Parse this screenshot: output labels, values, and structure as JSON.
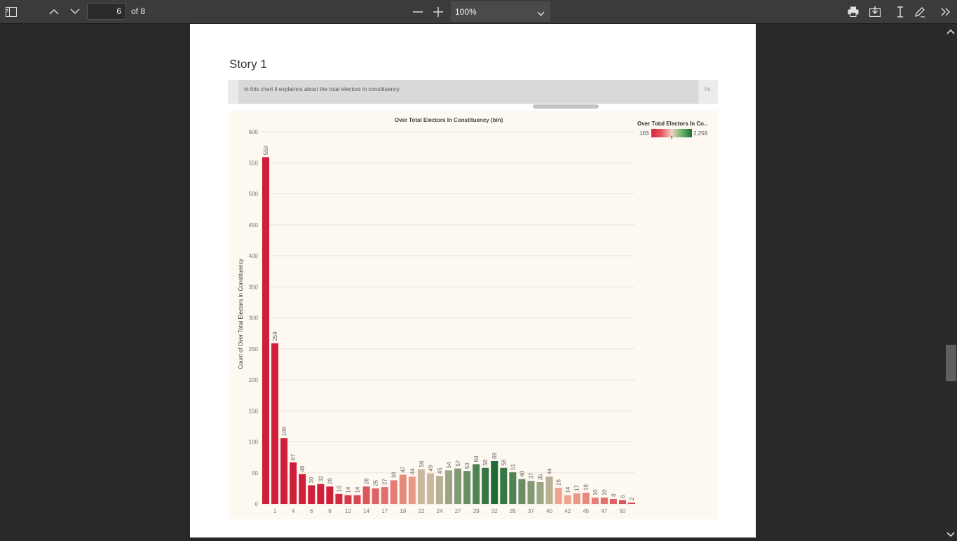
{
  "toolbar": {
    "page_current": "6",
    "page_of": "of 8",
    "zoom": "100%",
    "icons": [
      "sidebar-toggle-icon",
      "chevron-up-icon",
      "chevron-down-icon",
      "zoom-out-icon",
      "zoom-in-icon",
      "print-icon",
      "download-icon",
      "text-cursor-icon",
      "pen-icon",
      "more-chevron-icon"
    ]
  },
  "story": {
    "title": "Story 1",
    "left_point": ".",
    "active_point": "In this chart it explainns about the total electors in constituency",
    "right_point": "thi.."
  },
  "colors": {
    "low": "#d7263d",
    "mid": "#e8c7b4",
    "high": "#1e6b34",
    "chart_bg": "#fdf8f0"
  },
  "chart_data": {
    "type": "bar",
    "title": "Over Total Electors  In Constituency (bin)",
    "ylabel": "Count of Over Total Electors  In Constituency",
    "xlabel": "",
    "ylim": [
      0,
      600
    ],
    "yticks": [
      0,
      50,
      100,
      150,
      200,
      250,
      300,
      350,
      400,
      450,
      500,
      550,
      600
    ],
    "xtick_labels": [
      "1",
      "4",
      "6",
      "9",
      "12",
      "14",
      "17",
      "19",
      "22",
      "24",
      "27",
      "29",
      "32",
      "35",
      "37",
      "40",
      "42",
      "45",
      "47",
      "50"
    ],
    "values": [
      559,
      259,
      106,
      67,
      48,
      30,
      32,
      28,
      16,
      14,
      14,
      28,
      25,
      27,
      38,
      47,
      44,
      56,
      49,
      45,
      54,
      57,
      53,
      64,
      58,
      69,
      58,
      51,
      40,
      37,
      35,
      44,
      26,
      14,
      17,
      18,
      10,
      10,
      8,
      6,
      2
    ],
    "legend": {
      "title": "Over Total Electors  In Co..",
      "min_label": "103",
      "max_label": "2,258"
    }
  }
}
